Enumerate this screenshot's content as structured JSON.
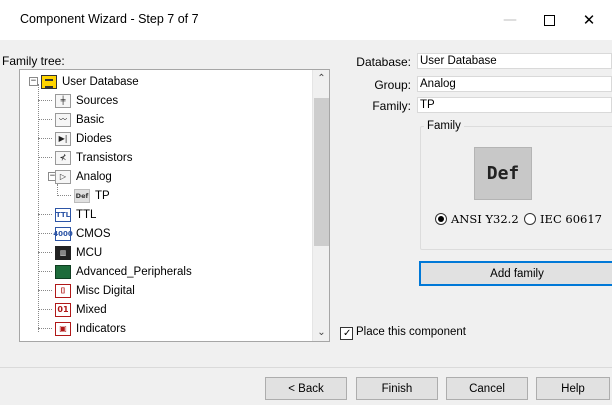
{
  "window": {
    "title": "Component Wizard - Step 7 of 7",
    "minimize_icon": "minimize-icon",
    "maximize_icon": "maximize-icon",
    "close_icon": "close-icon"
  },
  "tree": {
    "label": "Family tree:",
    "root": {
      "label": "User Database",
      "icon": "database-icon",
      "expanded": true
    },
    "items": [
      {
        "label": "Sources",
        "icon": "sources-icon"
      },
      {
        "label": "Basic",
        "icon": "basic-icon"
      },
      {
        "label": "Diodes",
        "icon": "diode-icon"
      },
      {
        "label": "Transistors",
        "icon": "transistor-icon"
      },
      {
        "label": "Analog",
        "icon": "analog-icon",
        "expanded": true
      },
      {
        "label": "TP",
        "icon": "def-icon",
        "selected": true
      },
      {
        "label": "TTL",
        "icon": "ttl-icon"
      },
      {
        "label": "CMOS",
        "icon": "cmos-icon"
      },
      {
        "label": "MCU",
        "icon": "mcu-icon"
      },
      {
        "label": "Advanced_Peripherals",
        "icon": "peripherals-icon"
      },
      {
        "label": "Misc Digital",
        "icon": "misc-digital-icon"
      },
      {
        "label": "Mixed",
        "icon": "mixed-icon"
      },
      {
        "label": "Indicators",
        "icon": "indicators-icon"
      }
    ],
    "scroll_up_icon": "scroll-up-icon",
    "scroll_down_icon": "scroll-down-icon"
  },
  "fields": {
    "database_label": "Database:",
    "database_value": "User Database",
    "group_label": "Group:",
    "group_value": "Analog",
    "family_label": "Family:",
    "family_value": "TP"
  },
  "family_group": {
    "label": "Family",
    "symbol_text": "Def",
    "radio_ansi": "ANSI Y32.2",
    "radio_iec": "IEC 60617",
    "selected_standard": "ANSI Y32.2"
  },
  "add_family_label": "Add family",
  "place_component": {
    "label": "Place this component",
    "checked": true
  },
  "buttons": {
    "back": "< Back",
    "finish": "Finish",
    "cancel": "Cancel",
    "help": "Help"
  },
  "colors": {
    "accent": "#0078d7",
    "background": "#f0f0f0",
    "tree_icon_root": "#ffd400"
  }
}
